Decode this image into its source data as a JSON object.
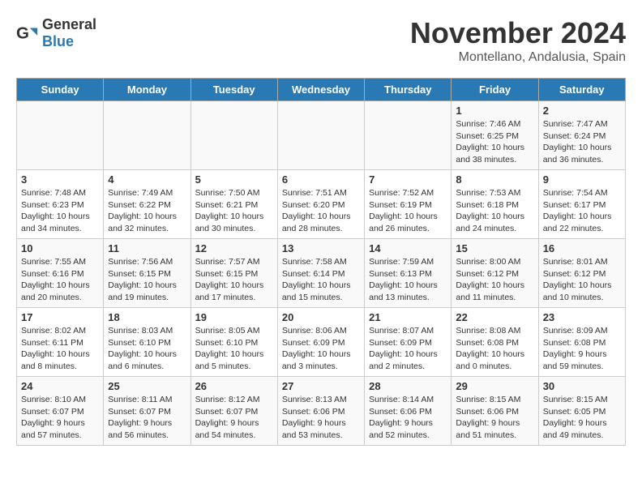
{
  "logo": {
    "general": "General",
    "blue": "Blue"
  },
  "header": {
    "month": "November 2024",
    "location": "Montellano, Andalusia, Spain"
  },
  "days_of_week": [
    "Sunday",
    "Monday",
    "Tuesday",
    "Wednesday",
    "Thursday",
    "Friday",
    "Saturday"
  ],
  "weeks": [
    [
      {
        "day": "",
        "info": ""
      },
      {
        "day": "",
        "info": ""
      },
      {
        "day": "",
        "info": ""
      },
      {
        "day": "",
        "info": ""
      },
      {
        "day": "",
        "info": ""
      },
      {
        "day": "1",
        "info": "Sunrise: 7:46 AM\nSunset: 6:25 PM\nDaylight: 10 hours and 38 minutes."
      },
      {
        "day": "2",
        "info": "Sunrise: 7:47 AM\nSunset: 6:24 PM\nDaylight: 10 hours and 36 minutes."
      }
    ],
    [
      {
        "day": "3",
        "info": "Sunrise: 7:48 AM\nSunset: 6:23 PM\nDaylight: 10 hours and 34 minutes."
      },
      {
        "day": "4",
        "info": "Sunrise: 7:49 AM\nSunset: 6:22 PM\nDaylight: 10 hours and 32 minutes."
      },
      {
        "day": "5",
        "info": "Sunrise: 7:50 AM\nSunset: 6:21 PM\nDaylight: 10 hours and 30 minutes."
      },
      {
        "day": "6",
        "info": "Sunrise: 7:51 AM\nSunset: 6:20 PM\nDaylight: 10 hours and 28 minutes."
      },
      {
        "day": "7",
        "info": "Sunrise: 7:52 AM\nSunset: 6:19 PM\nDaylight: 10 hours and 26 minutes."
      },
      {
        "day": "8",
        "info": "Sunrise: 7:53 AM\nSunset: 6:18 PM\nDaylight: 10 hours and 24 minutes."
      },
      {
        "day": "9",
        "info": "Sunrise: 7:54 AM\nSunset: 6:17 PM\nDaylight: 10 hours and 22 minutes."
      }
    ],
    [
      {
        "day": "10",
        "info": "Sunrise: 7:55 AM\nSunset: 6:16 PM\nDaylight: 10 hours and 20 minutes."
      },
      {
        "day": "11",
        "info": "Sunrise: 7:56 AM\nSunset: 6:15 PM\nDaylight: 10 hours and 19 minutes."
      },
      {
        "day": "12",
        "info": "Sunrise: 7:57 AM\nSunset: 6:15 PM\nDaylight: 10 hours and 17 minutes."
      },
      {
        "day": "13",
        "info": "Sunrise: 7:58 AM\nSunset: 6:14 PM\nDaylight: 10 hours and 15 minutes."
      },
      {
        "day": "14",
        "info": "Sunrise: 7:59 AM\nSunset: 6:13 PM\nDaylight: 10 hours and 13 minutes."
      },
      {
        "day": "15",
        "info": "Sunrise: 8:00 AM\nSunset: 6:12 PM\nDaylight: 10 hours and 11 minutes."
      },
      {
        "day": "16",
        "info": "Sunrise: 8:01 AM\nSunset: 6:12 PM\nDaylight: 10 hours and 10 minutes."
      }
    ],
    [
      {
        "day": "17",
        "info": "Sunrise: 8:02 AM\nSunset: 6:11 PM\nDaylight: 10 hours and 8 minutes."
      },
      {
        "day": "18",
        "info": "Sunrise: 8:03 AM\nSunset: 6:10 PM\nDaylight: 10 hours and 6 minutes."
      },
      {
        "day": "19",
        "info": "Sunrise: 8:05 AM\nSunset: 6:10 PM\nDaylight: 10 hours and 5 minutes."
      },
      {
        "day": "20",
        "info": "Sunrise: 8:06 AM\nSunset: 6:09 PM\nDaylight: 10 hours and 3 minutes."
      },
      {
        "day": "21",
        "info": "Sunrise: 8:07 AM\nSunset: 6:09 PM\nDaylight: 10 hours and 2 minutes."
      },
      {
        "day": "22",
        "info": "Sunrise: 8:08 AM\nSunset: 6:08 PM\nDaylight: 10 hours and 0 minutes."
      },
      {
        "day": "23",
        "info": "Sunrise: 8:09 AM\nSunset: 6:08 PM\nDaylight: 9 hours and 59 minutes."
      }
    ],
    [
      {
        "day": "24",
        "info": "Sunrise: 8:10 AM\nSunset: 6:07 PM\nDaylight: 9 hours and 57 minutes."
      },
      {
        "day": "25",
        "info": "Sunrise: 8:11 AM\nSunset: 6:07 PM\nDaylight: 9 hours and 56 minutes."
      },
      {
        "day": "26",
        "info": "Sunrise: 8:12 AM\nSunset: 6:07 PM\nDaylight: 9 hours and 54 minutes."
      },
      {
        "day": "27",
        "info": "Sunrise: 8:13 AM\nSunset: 6:06 PM\nDaylight: 9 hours and 53 minutes."
      },
      {
        "day": "28",
        "info": "Sunrise: 8:14 AM\nSunset: 6:06 PM\nDaylight: 9 hours and 52 minutes."
      },
      {
        "day": "29",
        "info": "Sunrise: 8:15 AM\nSunset: 6:06 PM\nDaylight: 9 hours and 51 minutes."
      },
      {
        "day": "30",
        "info": "Sunrise: 8:15 AM\nSunset: 6:05 PM\nDaylight: 9 hours and 49 minutes."
      }
    ]
  ]
}
